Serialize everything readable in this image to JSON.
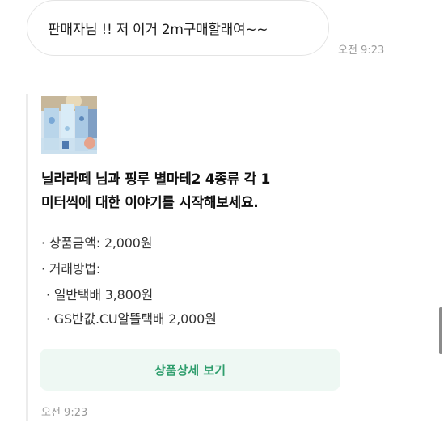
{
  "message": {
    "text": "판매자님 !! 저 이거 2m구매할래여~~",
    "time": "오전 9:23"
  },
  "card": {
    "thumbnail_icon": "washi-tape-rolls-photo",
    "title_line1": "닐라라떼 님과 핑루 별마테2 4종류 각 1",
    "title_line2": "미터씩에 대한 이야기를 시작해보세요.",
    "price_line": "· 상품금액: 2,000원",
    "method_label": "· 거래방법:",
    "method_options": [
      "· 일반택배 3,800원",
      "· GS반값.CU알뜰택배 2,000원"
    ],
    "detail_button": "상품상세 보기",
    "time": "오전 9:23"
  }
}
